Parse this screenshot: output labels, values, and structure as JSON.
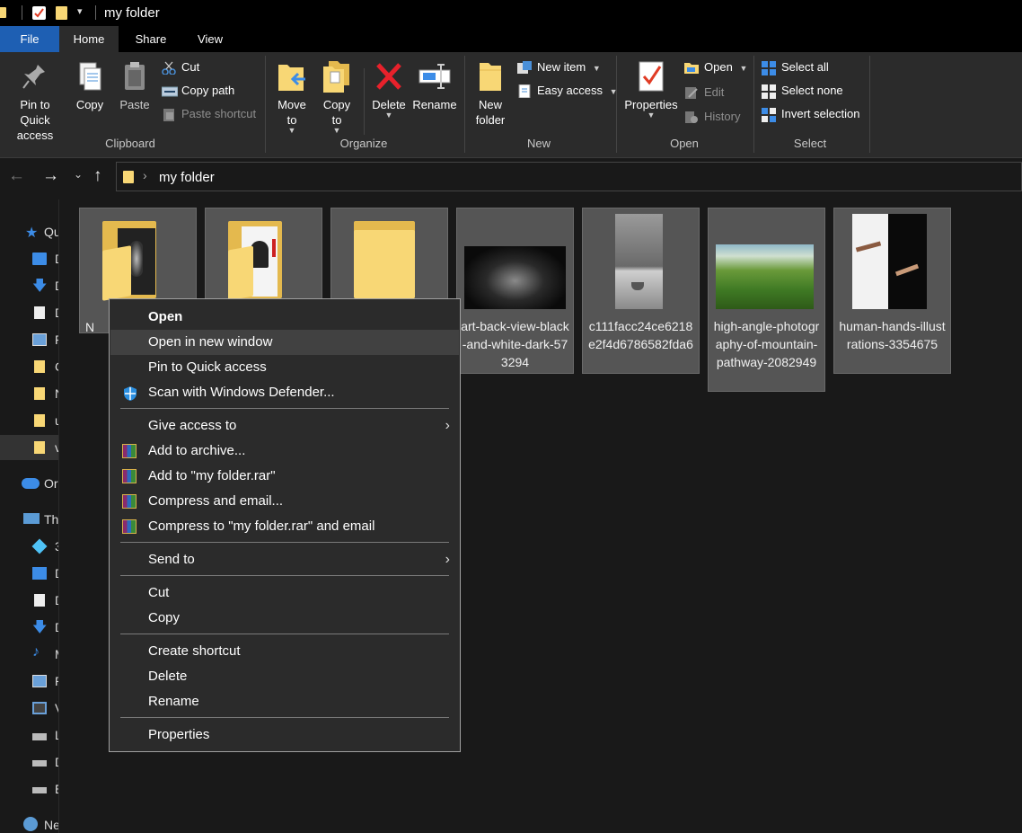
{
  "window": {
    "title": "my folder"
  },
  "tabs": [
    "File",
    "Home",
    "Share",
    "View"
  ],
  "ribbon": {
    "clipboard": {
      "pin": "Pin to Quick access",
      "copy": "Copy",
      "paste": "Paste",
      "cut": "Cut",
      "copy_path": "Copy path",
      "paste_shortcut": "Paste shortcut",
      "label": "Clipboard"
    },
    "organize": {
      "move_to": "Move to",
      "copy_to": "Copy to",
      "delete": "Delete",
      "rename": "Rename",
      "label": "Organize"
    },
    "new": {
      "new_folder": "New folder",
      "new_item": "New item",
      "easy_access": "Easy access",
      "label": "New"
    },
    "open": {
      "properties": "Properties",
      "open": "Open",
      "edit": "Edit",
      "history": "History",
      "label": "Open"
    },
    "select": {
      "select_all": "Select all",
      "select_none": "Select none",
      "invert": "Invert selection",
      "label": "Select"
    }
  },
  "address": {
    "path": "my folder"
  },
  "navpane": {
    "items": [
      {
        "label": "Qu"
      },
      {
        "label": "D"
      },
      {
        "label": "D"
      },
      {
        "label": "D"
      },
      {
        "label": "P"
      },
      {
        "label": "C"
      },
      {
        "label": "N"
      },
      {
        "label": "u"
      },
      {
        "label": "v"
      },
      {
        "label": "Or"
      },
      {
        "label": "Thi"
      },
      {
        "label": "3"
      },
      {
        "label": "D"
      },
      {
        "label": "D"
      },
      {
        "label": "D"
      },
      {
        "label": "M"
      },
      {
        "label": "P"
      },
      {
        "label": "V"
      },
      {
        "label": "L"
      },
      {
        "label": "D"
      },
      {
        "label": "E"
      },
      {
        "label": "Ne"
      }
    ]
  },
  "files": [
    {
      "name": "N"
    },
    {
      "name": ""
    },
    {
      "name": ""
    },
    {
      "name": "art-back-view-black-and-white-dark-573294"
    },
    {
      "name": "c111facc24ce6218e2f4d6786582fda6"
    },
    {
      "name": "high-angle-photography-of-mountain-pathway-2082949"
    },
    {
      "name": "human-hands-illustrations-3354675"
    }
  ],
  "context_menu": {
    "open": "Open",
    "open_new_window": "Open in new window",
    "pin_quick": "Pin to Quick access",
    "scan": "Scan with Windows Defender...",
    "give_access": "Give access to",
    "add_archive": "Add to archive...",
    "add_rar": "Add to \"my folder.rar\"",
    "compress_email": "Compress and email...",
    "compress_rar_email": "Compress to \"my folder.rar\" and email",
    "send_to": "Send to",
    "cut": "Cut",
    "copy": "Copy",
    "create_shortcut": "Create shortcut",
    "delete": "Delete",
    "rename": "Rename",
    "properties": "Properties"
  },
  "colors": {
    "accent": "#1e5fb3",
    "folder": "#f8d775",
    "bg": "#191919",
    "ribbon": "#2b2b2b"
  }
}
